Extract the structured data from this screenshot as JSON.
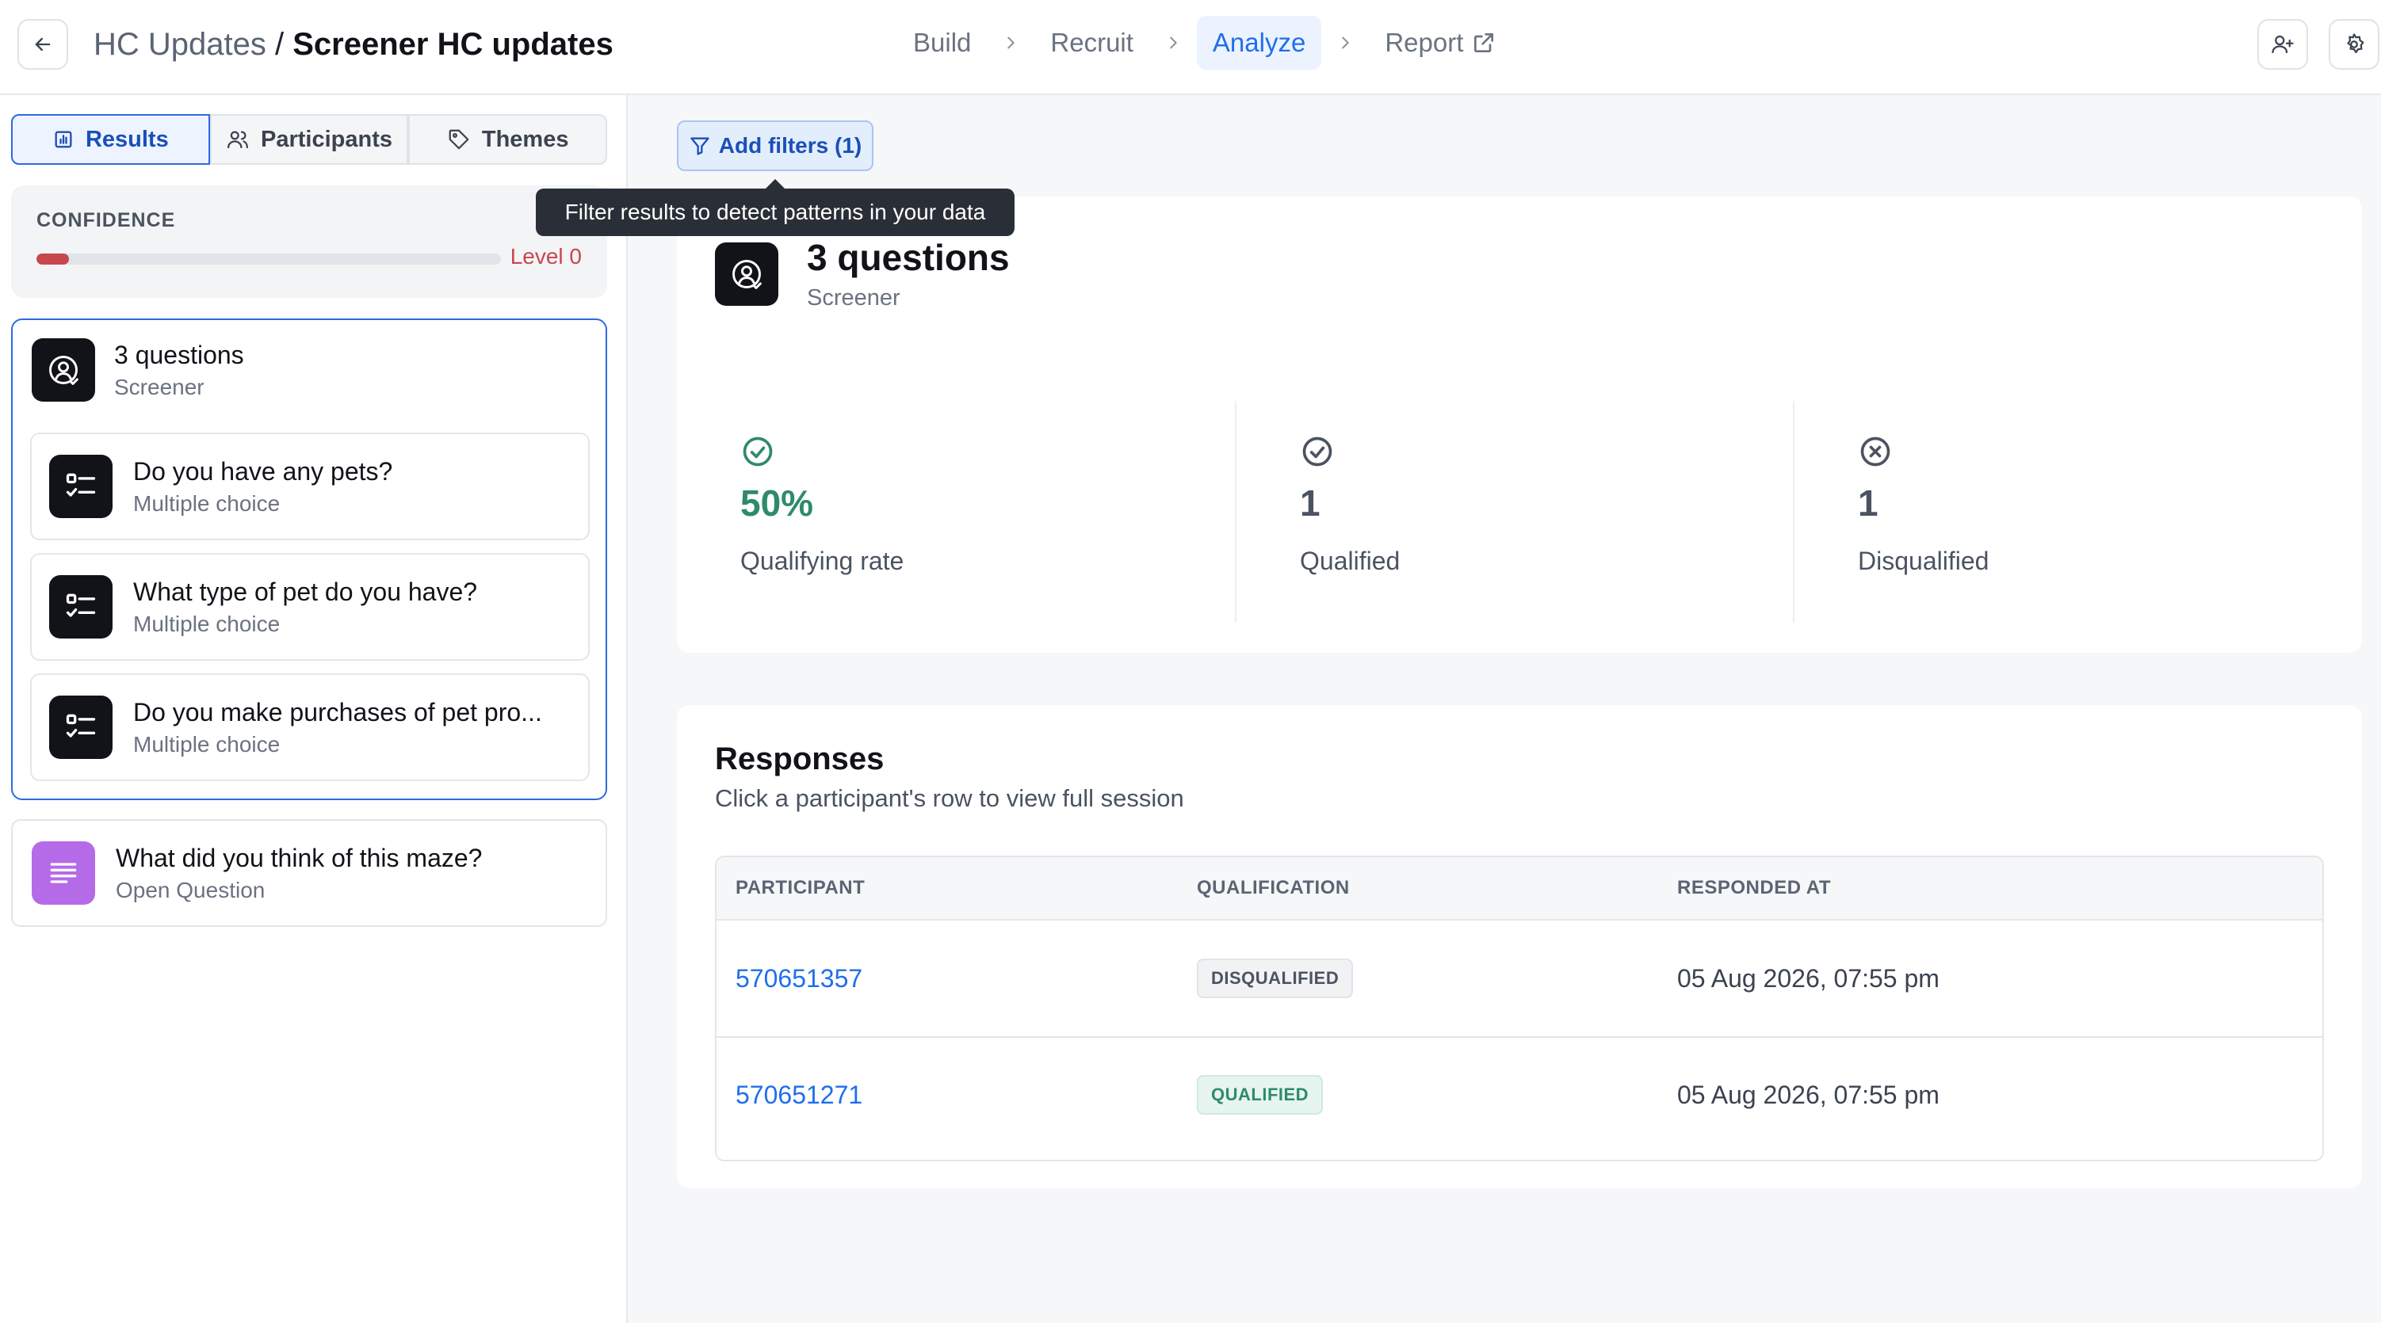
{
  "header": {
    "project": "HC Updates",
    "separator": " / ",
    "study": "Screener HC updates",
    "steps": [
      {
        "label": "Build"
      },
      {
        "label": "Recruit"
      },
      {
        "label": "Analyze"
      },
      {
        "label": "Report"
      }
    ],
    "active_step": "Analyze"
  },
  "sidebar": {
    "tabs": [
      {
        "label": "Results",
        "icon": "bar-chart-icon"
      },
      {
        "label": "Participants",
        "icon": "users-icon"
      },
      {
        "label": "Themes",
        "icon": "tag-icon"
      }
    ],
    "confidence": {
      "label": "CONFIDENCE",
      "level": "Level 0",
      "progress": 0.07
    },
    "screener": {
      "title": "3 questions",
      "subtitle": "Screener",
      "questions": [
        {
          "title": "Do you have any pets?",
          "type": "Multiple choice"
        },
        {
          "title": "What type of pet do you have?",
          "type": "Multiple choice"
        },
        {
          "title": "Do you make purchases of pet pro...",
          "type": "Multiple choice"
        }
      ]
    },
    "open_question": {
      "title": "What did you think of this maze?",
      "type": "Open Question"
    }
  },
  "filters": {
    "button_label": "Add filters (1)",
    "tooltip": "Filter results to detect patterns in your data"
  },
  "overview": {
    "title": "3 questions",
    "subtitle": "Screener",
    "stats": [
      {
        "value": "50%",
        "label": "Qualifying rate",
        "icon": "check-circle-icon"
      },
      {
        "value": "1",
        "label": "Qualified",
        "icon": "check-circle-icon"
      },
      {
        "value": "1",
        "label": "Disqualified",
        "icon": "x-circle-icon"
      }
    ]
  },
  "responses": {
    "title": "Responses",
    "subtitle": "Click a participant's row to view full session",
    "columns": [
      "PARTICIPANT",
      "QUALIFICATION",
      "RESPONDED AT"
    ],
    "rows": [
      {
        "participant": "570651357",
        "qualification": "DISQUALIFIED",
        "responded_at": "05 Aug 2026, 07:55 pm"
      },
      {
        "participant": "570651271",
        "qualification": "QUALIFIED",
        "responded_at": "05 Aug 2026, 07:55 pm"
      }
    ]
  },
  "colors": {
    "accent": "#1f6feb",
    "qualified": "#2f8a6c",
    "danger": "#c8474e",
    "question_icon_bg": "#111318",
    "open_question_icon_bg": "#b56be8"
  }
}
